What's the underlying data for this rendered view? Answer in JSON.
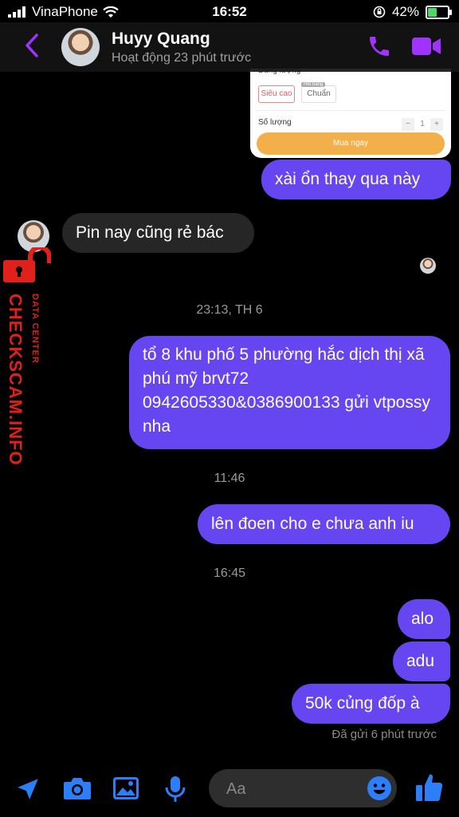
{
  "status_bar": {
    "carrier": "VinaPhone",
    "time": "16:52",
    "battery": "42%"
  },
  "header": {
    "name": "Huyy Quang",
    "status": "Hoạt động 23 phút trước"
  },
  "product_card": {
    "capacity_label": "Dung lượng",
    "option_selected": "Siêu cao",
    "option_other": "Chuẩn",
    "option_tag": "Hết hàng",
    "quantity_label": "Số lượng",
    "qty_minus": "−",
    "qty_value": "1",
    "qty_plus": "+",
    "buy_button": "Mua ngay"
  },
  "messages": {
    "m1": "xài ổn thay qua này",
    "m2": "Pin nay cũng rẻ bác",
    "ts1": "23:13, TH 6",
    "m3": "tổ 8 khu phố 5 phường hắc dịch thị xã phú mỹ brvt72 0942605330&0386900133 gửi vtpossy nha",
    "ts2": "11:46",
    "m4": "lên đoen cho e chưa anh iu",
    "ts3": "16:45",
    "m5": "alo",
    "m6": "adu",
    "m7": "50k củng đốp à",
    "sent_status": "Đã gửi 6 phút trước"
  },
  "watermark": {
    "main": "CHECKSCAM.INFO",
    "sub": "DATA CENTER"
  },
  "composer": {
    "placeholder": "Aa"
  },
  "colors": {
    "accent": "#a033ff",
    "bubble_out": "#6546f0",
    "bubble_in": "#262626"
  }
}
